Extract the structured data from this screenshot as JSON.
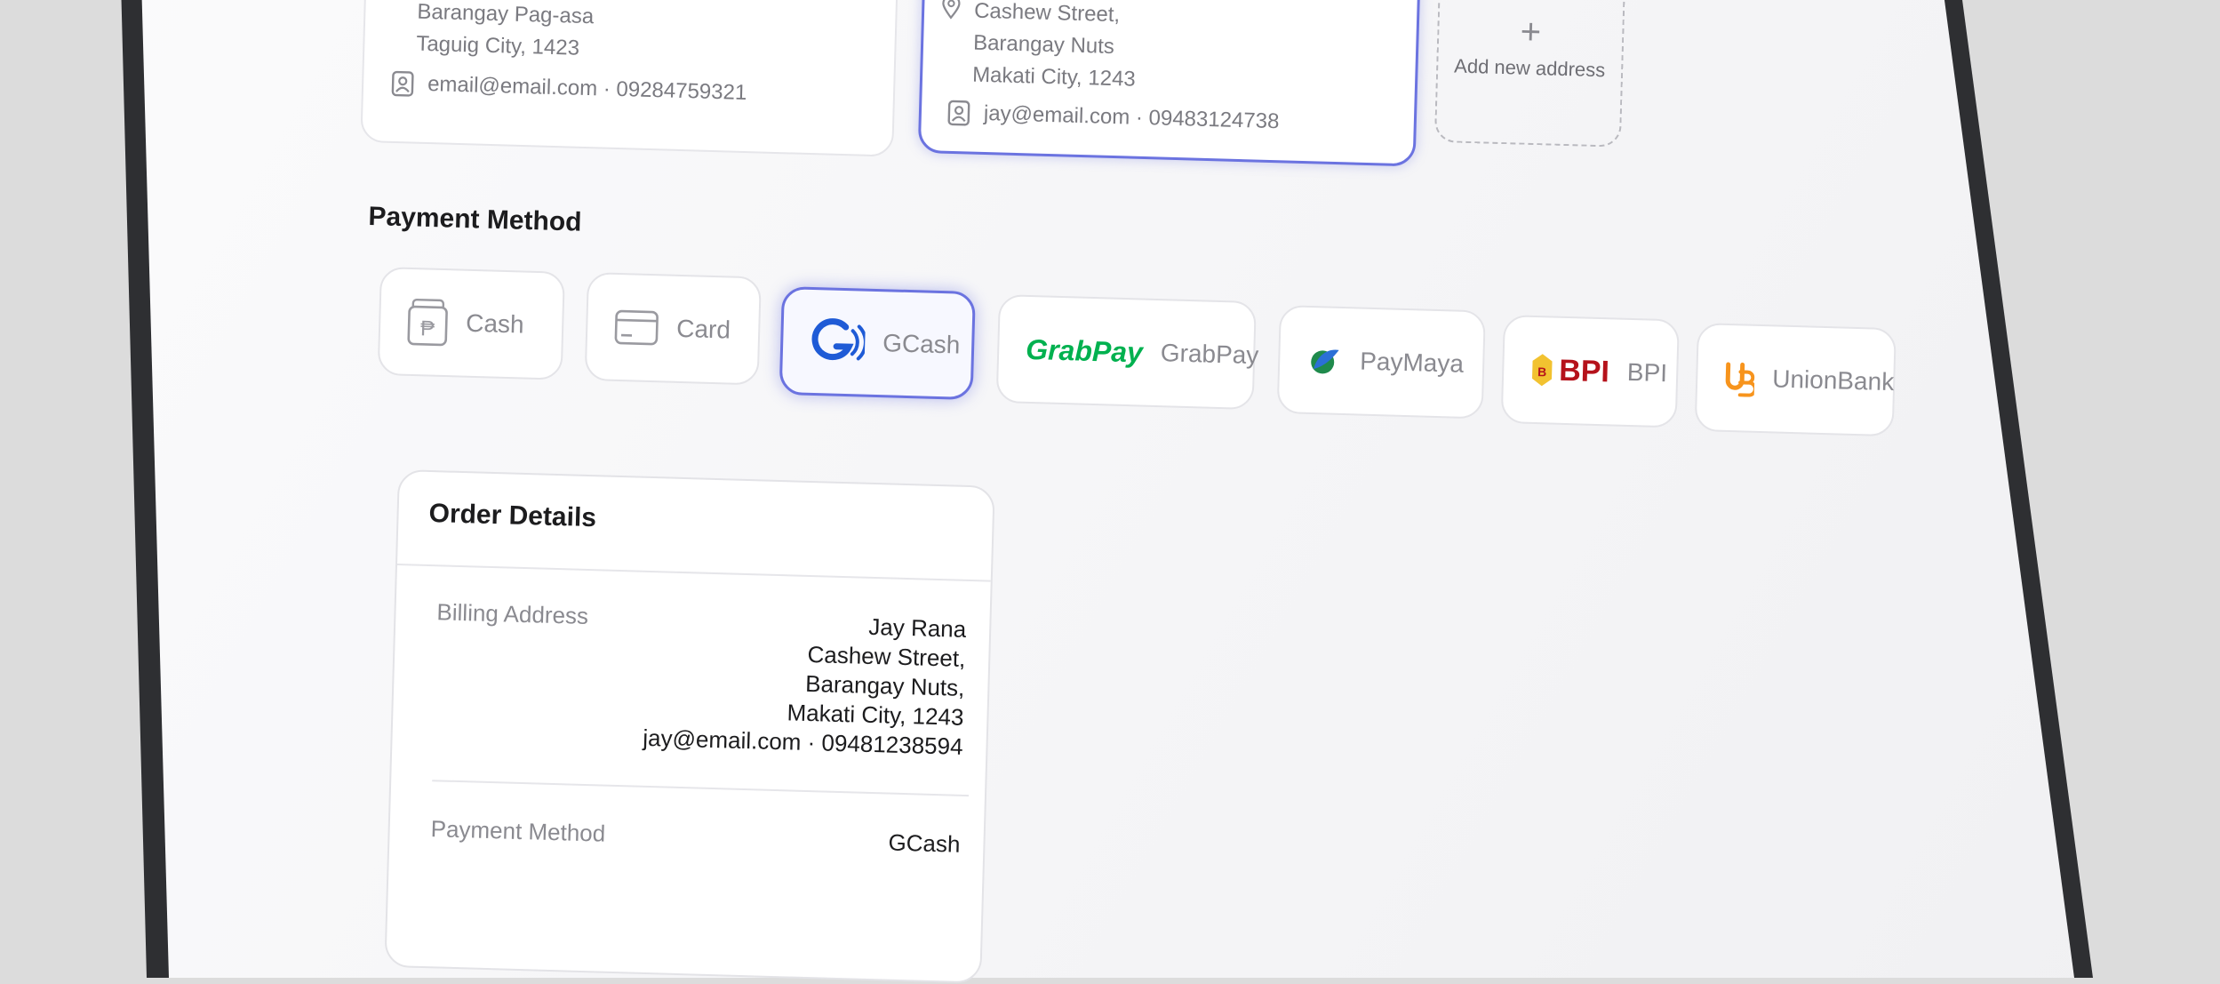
{
  "addresses": [
    {
      "lines": [
        "Barangay Pag-asa",
        "Taguig City, 1423"
      ],
      "contact": "email@email.com · 09284759321",
      "selected": false
    },
    {
      "lines": [
        "Cashew Street,",
        "Barangay Nuts",
        "Makati City, 1243"
      ],
      "contact": "jay@email.com · 09483124738",
      "selected": true
    }
  ],
  "add_address": {
    "label": "Add new address",
    "icon": "plus-icon"
  },
  "payment": {
    "title": "Payment Method",
    "options": [
      {
        "label": "Cash",
        "icon": "cash-icon",
        "selected": false
      },
      {
        "label": "Card",
        "icon": "card-icon",
        "selected": false
      },
      {
        "label": "GCash",
        "icon": "gcash-logo",
        "selected": true
      },
      {
        "label": "GrabPay",
        "logo_text": "GrabPay",
        "icon": "grabpay-logo",
        "selected": false
      },
      {
        "label": "PayMaya",
        "icon": "paymaya-logo",
        "selected": false
      },
      {
        "label": "BPI",
        "logo_text": "BPI",
        "icon": "bpi-logo",
        "selected": false
      },
      {
        "label": "UnionBank",
        "icon": "unionbank-logo",
        "selected": false
      }
    ]
  },
  "order": {
    "title": "Order Details",
    "billing_label": "Billing Address",
    "billing_lines": [
      "Jay Rana",
      "Cashew Street,",
      "Barangay Nuts,",
      "Makati City, 1243",
      "jay@email.com · 09481238594"
    ],
    "payment_label": "Payment Method",
    "payment_value": "GCash"
  },
  "colors": {
    "accent": "#6b73e0",
    "gcash": "#1f5bd6",
    "grabpay": "#00b14f",
    "bpi": "#b5121b",
    "unionbank": "#f7941d"
  }
}
